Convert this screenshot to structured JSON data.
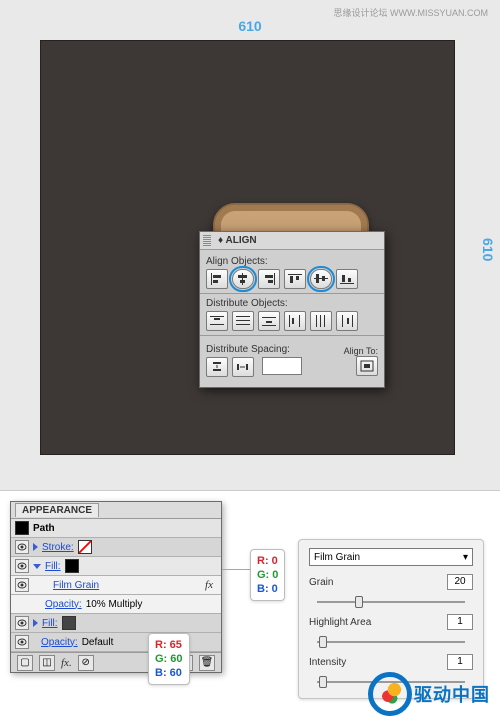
{
  "credit": "思缘设计论坛  WWW.MISSYUAN.COM",
  "dims": {
    "w": "610",
    "h": "610"
  },
  "align": {
    "title": "ALIGN",
    "sect1": "Align Objects:",
    "sect2": "Distribute Objects:",
    "sect3": "Distribute Spacing:",
    "alignto": "Align To:"
  },
  "appearance": {
    "title": "APPEARANCE",
    "path": "Path",
    "stroke": "Stroke:",
    "fill": "Fill:",
    "filmgrain": "Film Grain",
    "opacity1": "Opacity:",
    "opacity1val": "10% Multiply",
    "opacity2": "Opacity:",
    "opacity2val": "Default"
  },
  "rgb1": {
    "r": "R: 0",
    "g": "G: 0",
    "b": "B: 0"
  },
  "rgb2": {
    "r": "R: 65",
    "g": "G: 60",
    "b": "B: 60"
  },
  "fg": {
    "select": "Film Grain",
    "grain": "Grain",
    "grainv": "20",
    "hl": "Highlight Area",
    "hlv": "1",
    "int": "Intensity",
    "intv": "1"
  },
  "brand": "驱动中国"
}
